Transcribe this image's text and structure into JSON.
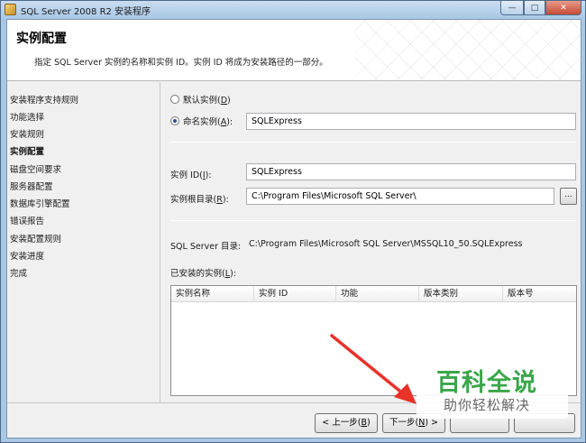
{
  "window": {
    "title": "SQL Server 2008 R2 安装程序",
    "minimize": "—",
    "maximize": "□",
    "close": "✕"
  },
  "header": {
    "title": "实例配置",
    "description": "指定 SQL Server 实例的名称和实例 ID。实例 ID 将成为安装路径的一部分。"
  },
  "nav": {
    "items": [
      {
        "label": "安装程序支持规则",
        "active": false
      },
      {
        "label": "功能选择",
        "active": false
      },
      {
        "label": "安装规则",
        "active": false
      },
      {
        "label": "实例配置",
        "active": true
      },
      {
        "label": "磁盘空间要求",
        "active": false
      },
      {
        "label": "服务器配置",
        "active": false
      },
      {
        "label": "数据库引擎配置",
        "active": false
      },
      {
        "label": "错误报告",
        "active": false
      },
      {
        "label": "安装配置规则",
        "active": false
      },
      {
        "label": "安装进度",
        "active": false
      },
      {
        "label": "完成",
        "active": false
      }
    ]
  },
  "form": {
    "default_instance": {
      "label": "默认实例(",
      "key": "D",
      "suffix": ")",
      "checked": false
    },
    "named_instance": {
      "label": "命名实例(",
      "key": "A",
      "suffix": "):",
      "checked": true,
      "value": "SQLExpress"
    },
    "instance_id": {
      "label": "实例 ID(",
      "key": "I",
      "suffix": "):",
      "value": "SQLExpress"
    },
    "instance_root": {
      "label": "实例根目录(",
      "key": "R",
      "suffix": "):",
      "value": "C:\\Program Files\\Microsoft SQL Server\\",
      "browse": "..."
    },
    "sql_dir": {
      "label": "SQL Server 目录:",
      "value": "C:\\Program Files\\Microsoft SQL Server\\MSSQL10_50.SQLExpress"
    },
    "installed": {
      "label": "已安装的实例(",
      "key": "L",
      "suffix": "):"
    }
  },
  "table": {
    "columns": [
      "实例名称",
      "实例 ID",
      "功能",
      "版本类别",
      "版本号"
    ],
    "rows": []
  },
  "buttons": {
    "back": {
      "prefix": "< 上一步(",
      "key": "B",
      "suffix": ")"
    },
    "next": {
      "prefix": "下一步(",
      "key": "N",
      "suffix": ") >"
    }
  },
  "watermark": {
    "main": "百科全说",
    "sub": "助你轻松解决"
  },
  "colors": {
    "annotation_arrow": "#e8322a",
    "watermark_green": "#3aa64a"
  }
}
